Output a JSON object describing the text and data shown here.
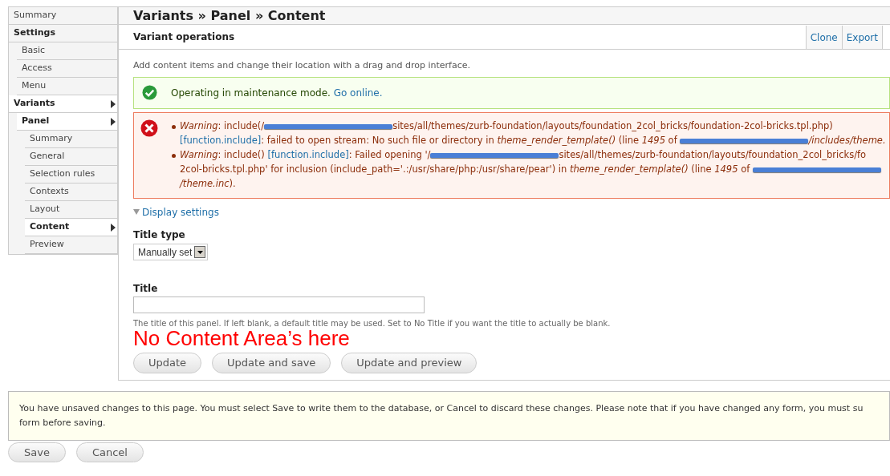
{
  "sidebar": {
    "items": [
      {
        "label": "Summary",
        "kind": "link",
        "selected": false
      },
      {
        "label": "Settings",
        "kind": "heading",
        "selected": false,
        "children": [
          {
            "label": "Basic",
            "kind": "link",
            "selected": false
          },
          {
            "label": "Access",
            "kind": "link",
            "selected": false
          },
          {
            "label": "Menu",
            "kind": "link",
            "selected": false
          }
        ]
      },
      {
        "label": "Variants",
        "kind": "link",
        "selected": true,
        "children": [
          {
            "label": "Panel",
            "kind": "link",
            "selected": true,
            "children": [
              {
                "label": "Summary",
                "kind": "link",
                "selected": false
              },
              {
                "label": "General",
                "kind": "link",
                "selected": false
              },
              {
                "label": "Selection rules",
                "kind": "link",
                "selected": false
              },
              {
                "label": "Contexts",
                "kind": "link",
                "selected": false
              },
              {
                "label": "Layout",
                "kind": "link",
                "selected": false
              },
              {
                "label": "Content",
                "kind": "link",
                "selected": true
              },
              {
                "label": "Preview",
                "kind": "link",
                "selected": false
              }
            ]
          }
        ]
      }
    ]
  },
  "page_title": "Variants » Panel » Content",
  "section": {
    "title": "Variant operations",
    "actions": [
      "Clone",
      "Export"
    ]
  },
  "description": "Add content items and change their location with a drag and drop interface.",
  "status_message": {
    "text": "Operating in maintenance mode.",
    "link": "Go online."
  },
  "warnings": [
    {
      "lines": [
        [
          {
            "kind": "italic",
            "text": "Warning"
          },
          {
            "kind": "text",
            "text": ": include(/"
          },
          {
            "kind": "redaction"
          },
          {
            "kind": "text",
            "text": "sites/all/themes/zurb-foundation/layouts/foundation_2col_bricks/foundation-2col-bricks.tpl.php)"
          }
        ],
        [
          {
            "kind": "link",
            "text": "[function.include]"
          },
          {
            "kind": "text",
            "text": ": failed to open stream: No such file or directory in "
          },
          {
            "kind": "italic",
            "text": "theme_render_template()"
          },
          {
            "kind": "text",
            "text": " (line "
          },
          {
            "kind": "italic",
            "text": "1495"
          },
          {
            "kind": "text",
            "text": " of "
          },
          {
            "kind": "redaction"
          },
          {
            "kind": "italic",
            "text": "/includes/theme."
          }
        ]
      ]
    },
    {
      "lines": [
        [
          {
            "kind": "italic",
            "text": "Warning"
          },
          {
            "kind": "text",
            "text": ": include() "
          },
          {
            "kind": "link",
            "text": "[function.include]"
          },
          {
            "kind": "text",
            "text": ": Failed opening '/"
          },
          {
            "kind": "redaction"
          },
          {
            "kind": "text",
            "text": "sites/all/themes/zurb-foundation/layouts/foundation_2col_bricks/fo"
          }
        ],
        [
          {
            "kind": "text",
            "text": "2col-bricks.tpl.php' for inclusion (include_path='.:/usr/share/php:/usr/share/pear') in "
          },
          {
            "kind": "italic",
            "text": "theme_render_template()"
          },
          {
            "kind": "text",
            "text": " (line "
          },
          {
            "kind": "italic",
            "text": "1495"
          },
          {
            "kind": "text",
            "text": " of "
          },
          {
            "kind": "redaction"
          }
        ],
        [
          {
            "kind": "italic",
            "text": "/theme.inc"
          },
          {
            "kind": "text",
            "text": ")."
          }
        ]
      ]
    }
  ],
  "display_settings": {
    "label": "Display settings",
    "expanded": true
  },
  "title_type": {
    "label": "Title type",
    "value": "Manually set"
  },
  "title_field": {
    "label": "Title",
    "description": "The title of this panel. If left blank, a default title may be used. Set to No Title if you want the title to actually be blank."
  },
  "annotation": "No Content Area’s here",
  "form_buttons": [
    "Update",
    "Update and save",
    "Update and preview"
  ],
  "unsaved_notice": {
    "line_1": "You have unsaved changes to this page. You must select Save to write them to the database, or Cancel to discard these changes. Please note that if you have changed any form, you must su",
    "line_2": "form before saving."
  },
  "page_buttons": [
    "Save",
    "Cancel"
  ]
}
